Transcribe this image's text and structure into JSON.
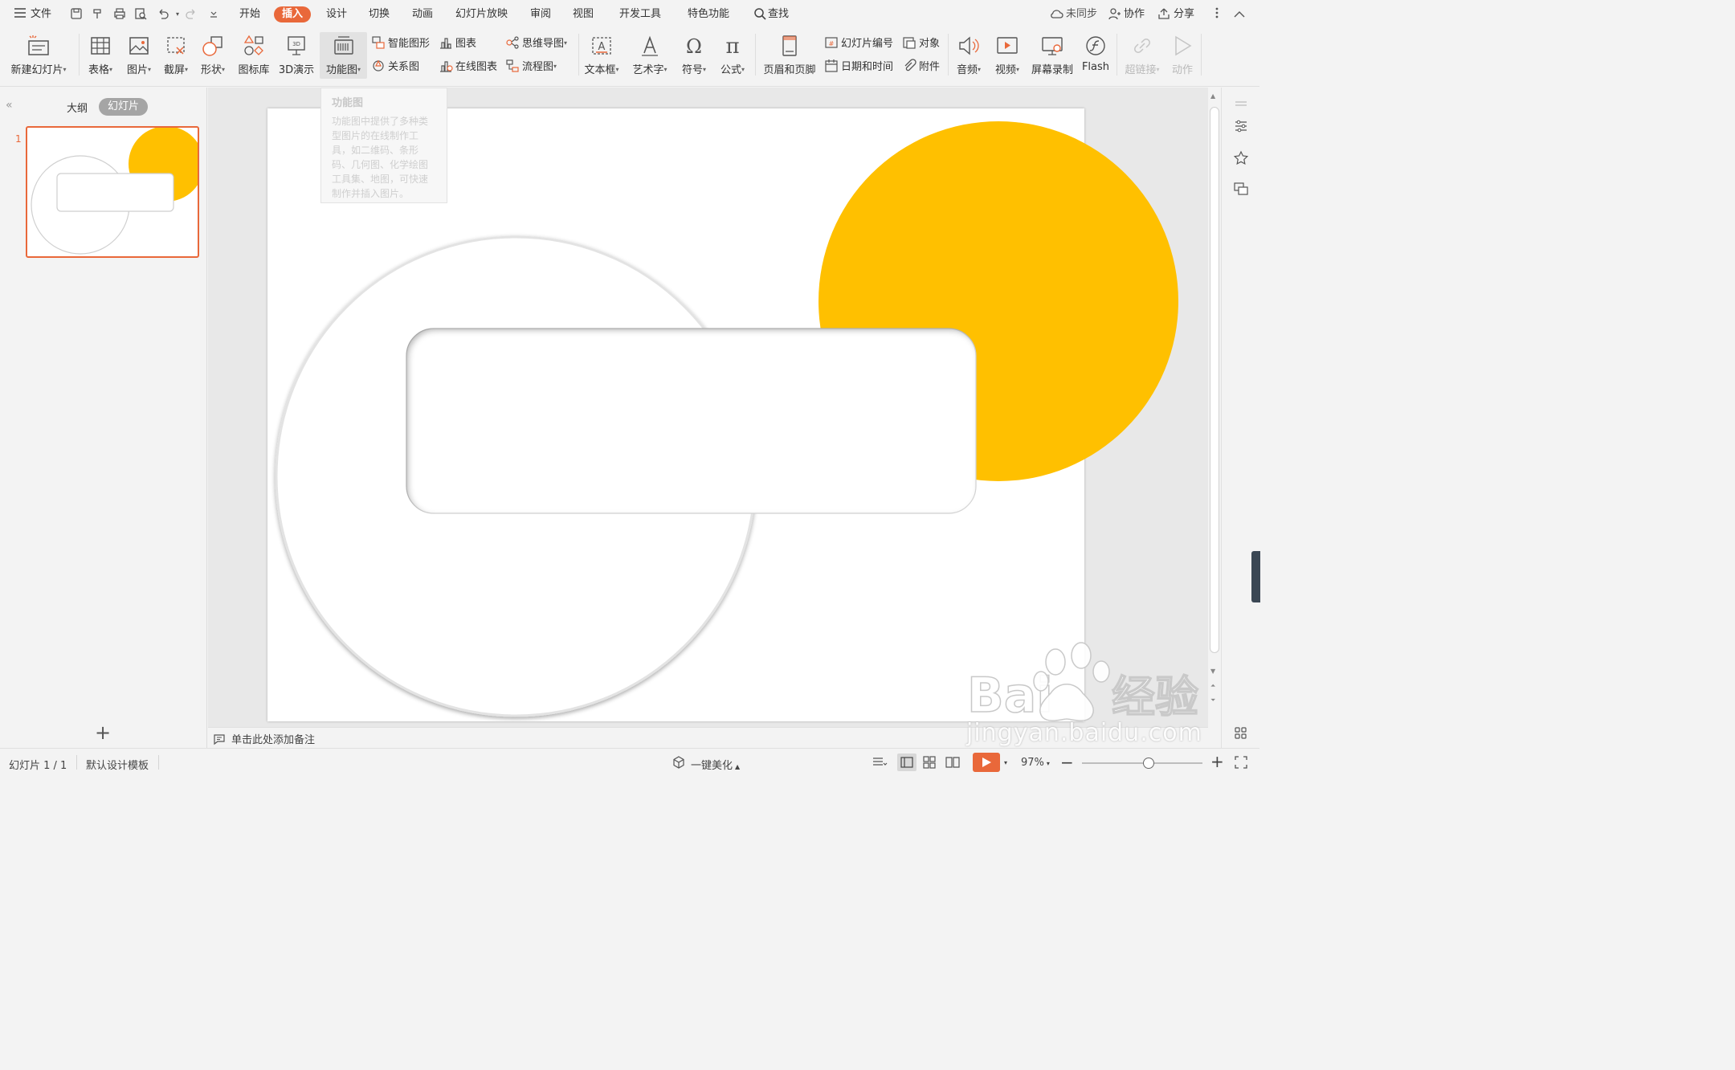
{
  "menubar": {
    "file": "文件",
    "tabs": [
      "开始",
      "插入",
      "设计",
      "切换",
      "动画",
      "幻灯片放映",
      "审阅",
      "视图",
      "开发工具",
      "特色功能"
    ],
    "search": "查找",
    "unsynced": "未同步",
    "collab": "协作",
    "share": "分享"
  },
  "ribbon": {
    "new_slide": "新建幻灯片",
    "table": "表格",
    "picture": "图片",
    "screenshot": "截屏",
    "shape": "形状",
    "icon_lib": "图标库",
    "demo3d": "3D演示",
    "func_graph": "功能图",
    "smart_art": "智能图形",
    "chart": "图表",
    "relation": "关系图",
    "online_chart": "在线图表",
    "mindmap": "思维导图",
    "flowchart": "流程图",
    "textbox": "文本框",
    "wordart": "艺术字",
    "symbol": "符号",
    "formula": "公式",
    "header_footer": "页眉和页脚",
    "slide_number": "幻灯片编号",
    "object": "对象",
    "datetime": "日期和时间",
    "attachment": "附件",
    "audio": "音频",
    "video": "视频",
    "screen_record": "屏幕录制",
    "flash": "Flash",
    "hyperlink": "超链接",
    "action": "动作"
  },
  "tooltip": {
    "title": "功能图",
    "body": "功能图中提供了多种类型图片的在线制作工具，如二维码、条形码、几何图、化学绘图工具集、地图，可快速制作并插入图片。"
  },
  "leftpanel": {
    "outline_tab": "大纲",
    "slides_tab": "幻灯片",
    "slide_number": "1"
  },
  "notes": {
    "placeholder": "单击此处添加备注"
  },
  "status": {
    "slide_info": "幻灯片 1 / 1",
    "template": "默认设计模板",
    "beautify": "一键美化",
    "zoom": "97%",
    "zoom_fraction": 0.55
  },
  "colors": {
    "accent": "#e9683a",
    "yellow_circle": "#ffc000"
  },
  "watermark": {
    "text": "jingyan.baidu.com"
  }
}
